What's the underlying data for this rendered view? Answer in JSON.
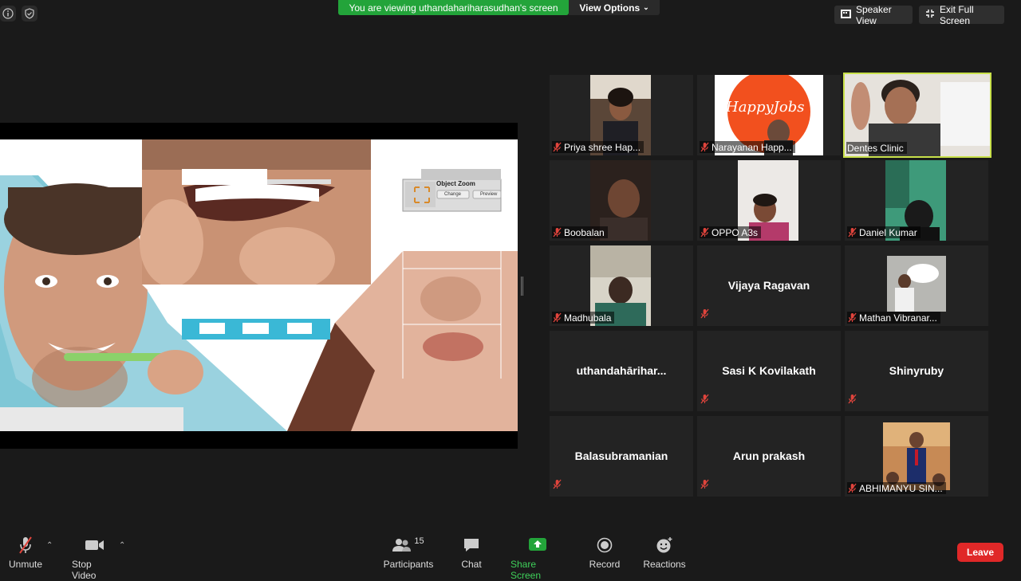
{
  "banner": {
    "text": "You are viewing uthandahariharasudhan's screen",
    "view_options": "View Options"
  },
  "top_right": {
    "speaker_view": "Speaker View",
    "exit_full_screen": "Exit Full Screen"
  },
  "slide": {
    "zoom_title": "Object Zoom",
    "zoom_change": "Change",
    "zoom_preview": "Preview",
    "logo_text": "HappyJobs"
  },
  "participants": [
    {
      "name": "Priya shree Hap..."
    },
    {
      "name": "Narayanan Happ..."
    },
    {
      "name": "Dentes Clinic"
    },
    {
      "name": "Boobalan"
    },
    {
      "name": "OPPO A3s"
    },
    {
      "name": "Daniel Kumar"
    },
    {
      "name": "Madhubala"
    },
    {
      "name": "Vijaya Ragavan"
    },
    {
      "name": "Mathan Vibranar..."
    },
    {
      "name": "uthandahariharasudhan",
      "display": "uthandahārihar..."
    },
    {
      "name": "Sasi K Kovilakath"
    },
    {
      "name": "Shinyruby"
    },
    {
      "name": "Balasubramanian"
    },
    {
      "name": "Arun prakash"
    },
    {
      "name": "ABHIMANYU SIN..."
    }
  ],
  "toolbar": {
    "unmute": "Unmute",
    "stop_video": "Stop Video",
    "participants": "Participants",
    "participants_count": "15",
    "chat": "Chat",
    "share_screen": "Share Screen",
    "record": "Record",
    "reactions": "Reactions",
    "leave": "Leave"
  },
  "colors": {
    "accent_green": "#23a43a",
    "leave_red": "#e02828",
    "active_speaker": "#c8e04a",
    "muted_red": "#e0443c"
  }
}
